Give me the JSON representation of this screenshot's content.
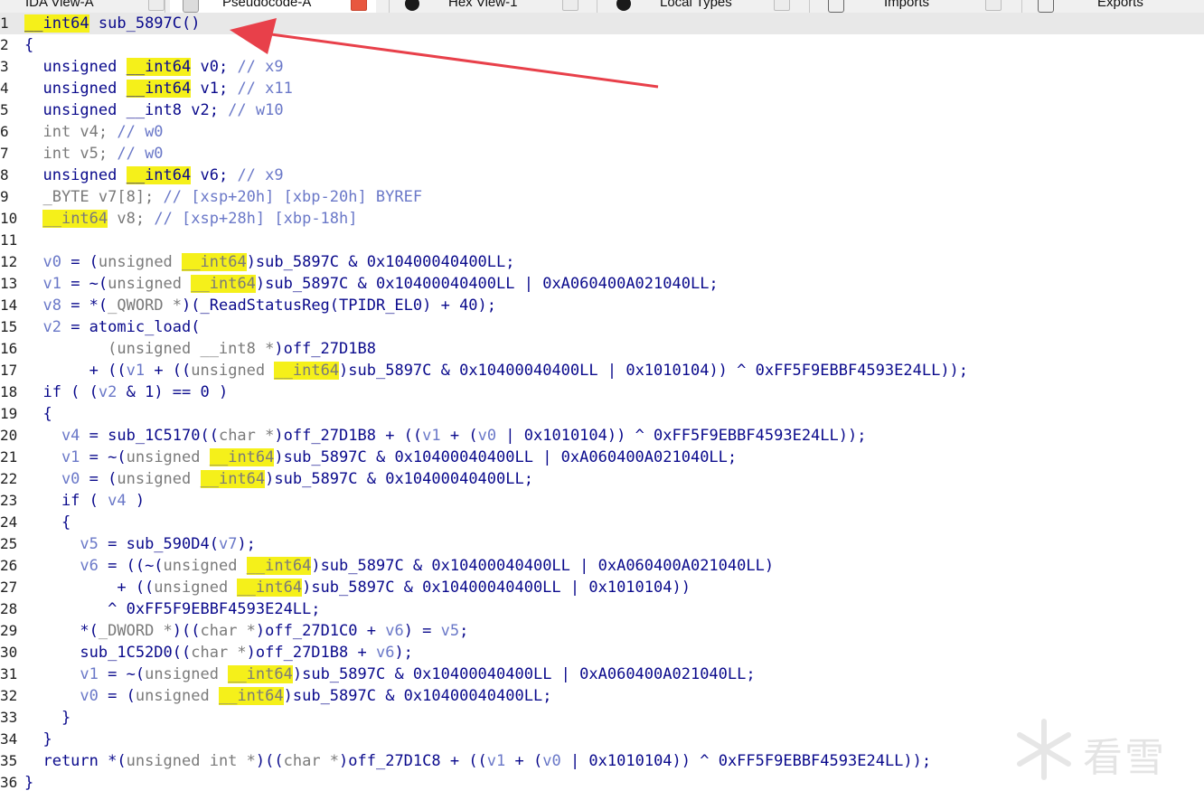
{
  "tabs": [
    {
      "label": "IDA View-A",
      "active": false
    },
    {
      "label": "Pseudocode-A",
      "active": true
    },
    {
      "label": "Hex View-1",
      "active": false
    },
    {
      "label": "Local Types",
      "active": false
    },
    {
      "label": "Imports",
      "active": false
    },
    {
      "label": "Exports",
      "active": false
    }
  ],
  "code_lines": [
    {
      "n": "1",
      "segs": [
        [
          "hl2",
          "__int64"
        ],
        [
          "k",
          " sub_5897C()"
        ]
      ],
      "current": true
    },
    {
      "n": "2",
      "segs": [
        [
          "k",
          "{"
        ]
      ]
    },
    {
      "n": "3",
      "segs": [
        [
          "k",
          "  unsigned "
        ],
        [
          "hl2",
          "__int64"
        ],
        [
          "k",
          " v0; "
        ],
        [
          "c",
          "// x9"
        ]
      ]
    },
    {
      "n": "4",
      "segs": [
        [
          "k",
          "  unsigned "
        ],
        [
          "hl2",
          "__int64"
        ],
        [
          "k",
          " v1; "
        ],
        [
          "c",
          "// x11"
        ]
      ]
    },
    {
      "n": "5",
      "segs": [
        [
          "k",
          "  unsigned __int8 v2; "
        ],
        [
          "c",
          "// w10"
        ]
      ]
    },
    {
      "n": "6",
      "segs": [
        [
          "g",
          "  int v4; "
        ],
        [
          "c",
          "// w0"
        ]
      ]
    },
    {
      "n": "7",
      "segs": [
        [
          "g",
          "  int v5; "
        ],
        [
          "c",
          "// w0"
        ]
      ]
    },
    {
      "n": "8",
      "segs": [
        [
          "k",
          "  unsigned "
        ],
        [
          "hl2",
          "__int64"
        ],
        [
          "k",
          " v6; "
        ],
        [
          "c",
          "// x9"
        ]
      ]
    },
    {
      "n": "9",
      "segs": [
        [
          "g",
          "  _BYTE v7[8]; "
        ],
        [
          "c",
          "// [xsp+20h] [xbp-20h] BYREF"
        ]
      ]
    },
    {
      "n": "10",
      "segs": [
        [
          "g",
          "  "
        ],
        [
          "hl",
          "__int64"
        ],
        [
          "g",
          " v8; "
        ],
        [
          "c",
          "// [xsp+28h] [xbp-18h]"
        ]
      ]
    },
    {
      "n": "11",
      "segs": [
        [
          "k",
          ""
        ]
      ]
    },
    {
      "n": "12",
      "segs": [
        [
          "v",
          "  v0"
        ],
        [
          "k",
          " = ("
        ],
        [
          "g",
          "unsigned "
        ],
        [
          "hl",
          "__int64"
        ],
        [
          "k",
          ")sub_5897C & 0x10400040400LL;"
        ]
      ]
    },
    {
      "n": "13",
      "segs": [
        [
          "v",
          "  v1"
        ],
        [
          "k",
          " = ~("
        ],
        [
          "g",
          "unsigned "
        ],
        [
          "hl",
          "__int64"
        ],
        [
          "k",
          ")sub_5897C & 0x10400040400LL | 0xA060400A021040LL;"
        ]
      ]
    },
    {
      "n": "14",
      "segs": [
        [
          "v",
          "  v8"
        ],
        [
          "k",
          " = *("
        ],
        [
          "g",
          "_QWORD *"
        ],
        [
          "k",
          ")(_ReadStatusReg(TPIDR_EL0) + 40);"
        ]
      ]
    },
    {
      "n": "15",
      "segs": [
        [
          "v",
          "  v2"
        ],
        [
          "k",
          " = atomic_load("
        ]
      ]
    },
    {
      "n": "16",
      "segs": [
        [
          "g",
          "         (unsigned __int8 *"
        ],
        [
          "k",
          ")off_27D1B8"
        ]
      ]
    },
    {
      "n": "17",
      "segs": [
        [
          "k",
          "       + (("
        ],
        [
          "v",
          "v1"
        ],
        [
          "k",
          " + (("
        ],
        [
          "g",
          "unsigned "
        ],
        [
          "hl",
          "__int64"
        ],
        [
          "k",
          ")sub_5897C & 0x10400040400LL | 0x1010104)) ^ 0xFF5F9EBBF4593E24LL));"
        ]
      ]
    },
    {
      "n": "18",
      "segs": [
        [
          "k",
          "  if ( ("
        ],
        [
          "v",
          "v2"
        ],
        [
          "k",
          " & 1) == 0 )"
        ]
      ]
    },
    {
      "n": "19",
      "segs": [
        [
          "k",
          "  {"
        ]
      ]
    },
    {
      "n": "20",
      "segs": [
        [
          "v",
          "    v4"
        ],
        [
          "k",
          " = sub_1C5170(("
        ],
        [
          "g",
          "char *"
        ],
        [
          "k",
          ")off_27D1B8 + (("
        ],
        [
          "v",
          "v1"
        ],
        [
          "k",
          " + ("
        ],
        [
          "v",
          "v0"
        ],
        [
          "k",
          " | 0x1010104)) ^ 0xFF5F9EBBF4593E24LL));"
        ]
      ]
    },
    {
      "n": "21",
      "segs": [
        [
          "v",
          "    v1"
        ],
        [
          "k",
          " = ~("
        ],
        [
          "g",
          "unsigned "
        ],
        [
          "hl",
          "__int64"
        ],
        [
          "k",
          ")sub_5897C & 0x10400040400LL | 0xA060400A021040LL;"
        ]
      ]
    },
    {
      "n": "22",
      "segs": [
        [
          "v",
          "    v0"
        ],
        [
          "k",
          " = ("
        ],
        [
          "g",
          "unsigned "
        ],
        [
          "hl",
          "__int64"
        ],
        [
          "k",
          ")sub_5897C & 0x10400040400LL;"
        ]
      ]
    },
    {
      "n": "23",
      "segs": [
        [
          "k",
          "    if ( "
        ],
        [
          "v",
          "v4"
        ],
        [
          "k",
          " )"
        ]
      ]
    },
    {
      "n": "24",
      "segs": [
        [
          "k",
          "    {"
        ]
      ]
    },
    {
      "n": "25",
      "segs": [
        [
          "v",
          "      v5"
        ],
        [
          "k",
          " = sub_590D4("
        ],
        [
          "v",
          "v7"
        ],
        [
          "k",
          ");"
        ]
      ]
    },
    {
      "n": "26",
      "segs": [
        [
          "v",
          "      v6"
        ],
        [
          "k",
          " = ((~("
        ],
        [
          "g",
          "unsigned "
        ],
        [
          "hl",
          "__int64"
        ],
        [
          "k",
          ")sub_5897C & 0x10400040400LL | 0xA060400A021040LL)"
        ]
      ]
    },
    {
      "n": "27",
      "segs": [
        [
          "k",
          "          + (("
        ],
        [
          "g",
          "unsigned "
        ],
        [
          "hl",
          "__int64"
        ],
        [
          "k",
          ")sub_5897C & 0x10400040400LL | 0x1010104))"
        ]
      ]
    },
    {
      "n": "28",
      "segs": [
        [
          "k",
          "         ^ 0xFF5F9EBBF4593E24LL;"
        ]
      ]
    },
    {
      "n": "29",
      "segs": [
        [
          "k",
          "      *("
        ],
        [
          "g",
          "_DWORD *"
        ],
        [
          "k",
          ")(("
        ],
        [
          "g",
          "char *"
        ],
        [
          "k",
          ")off_27D1C0 + "
        ],
        [
          "v",
          "v6"
        ],
        [
          "k",
          ") = "
        ],
        [
          "v",
          "v5"
        ],
        [
          "k",
          ";"
        ]
      ]
    },
    {
      "n": "30",
      "segs": [
        [
          "k",
          "      sub_1C52D0(("
        ],
        [
          "g",
          "char *"
        ],
        [
          "k",
          ")off_27D1B8 + "
        ],
        [
          "v",
          "v6"
        ],
        [
          "k",
          ");"
        ]
      ]
    },
    {
      "n": "31",
      "segs": [
        [
          "v",
          "      v1"
        ],
        [
          "k",
          " = ~("
        ],
        [
          "g",
          "unsigned "
        ],
        [
          "hl",
          "__int64"
        ],
        [
          "k",
          ")sub_5897C & 0x10400040400LL | 0xA060400A021040LL;"
        ]
      ]
    },
    {
      "n": "32",
      "segs": [
        [
          "v",
          "      v0"
        ],
        [
          "k",
          " = ("
        ],
        [
          "g",
          "unsigned "
        ],
        [
          "hl",
          "__int64"
        ],
        [
          "k",
          ")sub_5897C & 0x10400040400LL;"
        ]
      ]
    },
    {
      "n": "33",
      "segs": [
        [
          "k",
          "    }"
        ]
      ]
    },
    {
      "n": "34",
      "segs": [
        [
          "k",
          "  }"
        ]
      ]
    },
    {
      "n": "35",
      "segs": [
        [
          "k",
          "  return *("
        ],
        [
          "g",
          "unsigned int *"
        ],
        [
          "k",
          ")(("
        ],
        [
          "g",
          "char *"
        ],
        [
          "k",
          ")off_27D1C8 + (("
        ],
        [
          "v",
          "v1"
        ],
        [
          "k",
          " + ("
        ],
        [
          "v",
          "v0"
        ],
        [
          "k",
          " | 0x1010104)) ^ 0xFF5F9EBBF4593E24LL));"
        ]
      ]
    },
    {
      "n": "36",
      "segs": [
        [
          "k",
          "}"
        ]
      ]
    }
  ],
  "watermark": {
    "text": "看雪",
    "icon": "snowflake-icon"
  },
  "colors": {
    "highlight": "#f5f01a",
    "code": "#0a0a8c",
    "comment": "#6a78c8",
    "type_gray": "#7a7a7a",
    "arrow": "#e8404a"
  }
}
